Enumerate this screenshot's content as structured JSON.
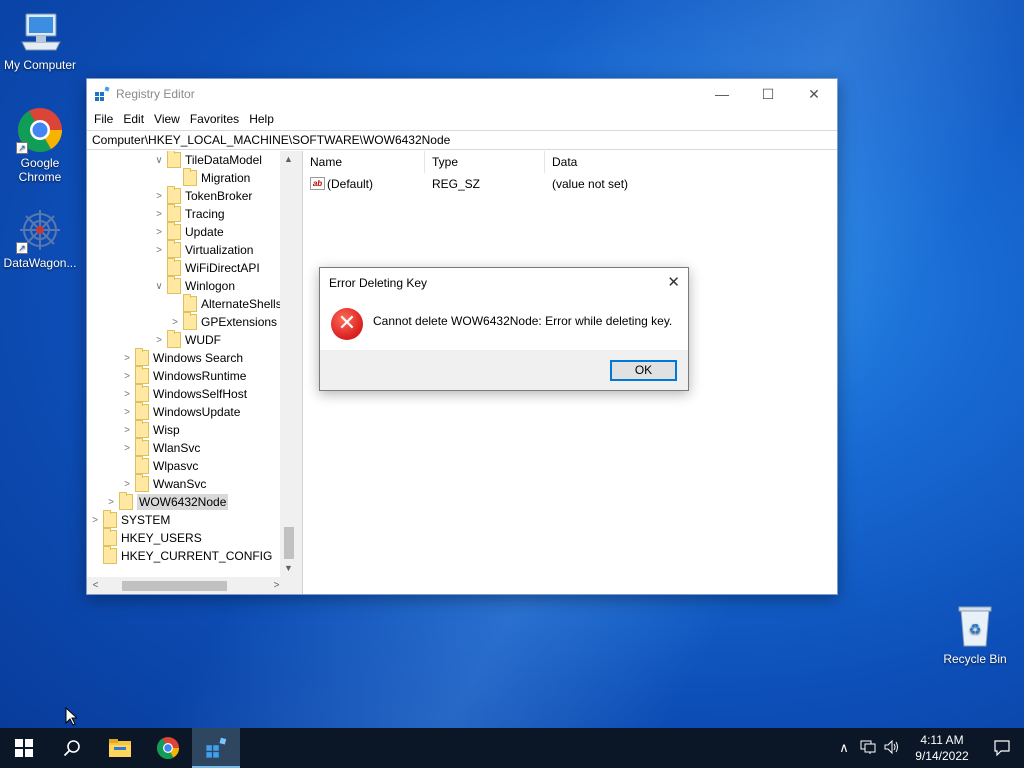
{
  "desktop": {
    "icons": [
      {
        "label": "My Computer"
      },
      {
        "label": "Google Chrome"
      },
      {
        "label": "DataWagon..."
      },
      {
        "label": "Recycle Bin"
      }
    ]
  },
  "window": {
    "title": "Registry Editor",
    "controls": {
      "minimize": "—",
      "maximize": "☐",
      "close": "✕"
    },
    "menu": [
      "File",
      "Edit",
      "View",
      "Favorites",
      "Help"
    ],
    "address": "Computer\\HKEY_LOCAL_MACHINE\\SOFTWARE\\WOW6432Node",
    "tree": [
      {
        "label": "TileDataModel",
        "expander": "∨"
      },
      {
        "label": "Migration",
        "expander": ""
      },
      {
        "label": "TokenBroker",
        "expander": ">"
      },
      {
        "label": "Tracing",
        "expander": ">"
      },
      {
        "label": "Update",
        "expander": ">"
      },
      {
        "label": "Virtualization",
        "expander": ">"
      },
      {
        "label": "WiFiDirectAPI",
        "expander": ""
      },
      {
        "label": "Winlogon",
        "expander": "∨"
      },
      {
        "label": "AlternateShells",
        "expander": ""
      },
      {
        "label": "GPExtensions",
        "expander": ">"
      },
      {
        "label": "WUDF",
        "expander": ">"
      },
      {
        "label": "Windows Search",
        "expander": ">"
      },
      {
        "label": "WindowsRuntime",
        "expander": ">"
      },
      {
        "label": "WindowsSelfHost",
        "expander": ">"
      },
      {
        "label": "WindowsUpdate",
        "expander": ">"
      },
      {
        "label": "Wisp",
        "expander": ">"
      },
      {
        "label": "WlanSvc",
        "expander": ">"
      },
      {
        "label": "Wlpasvc",
        "expander": ""
      },
      {
        "label": "WwanSvc",
        "expander": ">"
      },
      {
        "label": "WOW6432Node",
        "expander": ">"
      },
      {
        "label": "SYSTEM",
        "expander": ">"
      },
      {
        "label": "HKEY_USERS",
        "expander": ""
      },
      {
        "label": "HKEY_CURRENT_CONFIG",
        "expander": ""
      }
    ],
    "columns": {
      "name": "Name",
      "type": "Type",
      "data": "Data"
    },
    "values": [
      {
        "name": "(Default)",
        "type": "REG_SZ",
        "data": "(value not set)",
        "icon": "ab"
      }
    ]
  },
  "dialog": {
    "title": "Error Deleting Key",
    "close": "✕",
    "message": "Cannot delete WOW6432Node:  Error while deleting key.",
    "ok_label": "OK"
  },
  "taskbar": {
    "time": "4:11 AM",
    "date": "9/14/2022",
    "tray_chevron": "∧"
  },
  "colors": {
    "accent": "#0078d7",
    "error": "#d81e1e",
    "taskbar": "#0b1626"
  }
}
